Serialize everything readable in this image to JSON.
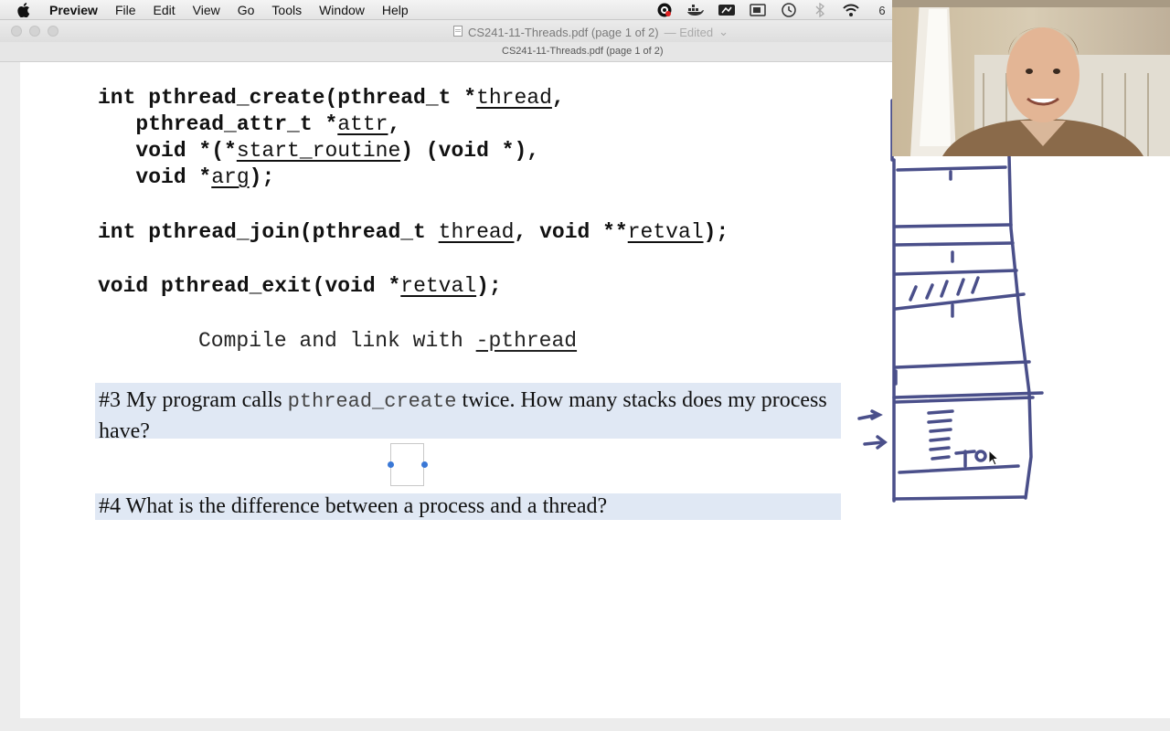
{
  "menubar": {
    "app": "Preview",
    "items": [
      "File",
      "Edit",
      "View",
      "Go",
      "Tools",
      "Window",
      "Help"
    ],
    "status_icons": [
      "creative-cloud-icon",
      "docker-icon",
      "cloud-sync-icon",
      "screen-capture-icon",
      "time-machine-icon",
      "bluetooth-icon",
      "wifi-icon"
    ],
    "clock_partial": "6"
  },
  "window": {
    "title": "CS241-11-Threads.pdf (page 1 of 2)",
    "edited": "— Edited",
    "page_info": "CS241-11-Threads.pdf (page 1 of 2)"
  },
  "document": {
    "create": {
      "l1_prefix": "int pthread_create(pthread_t *",
      "l1_arg": "thread",
      "l1_suffix": ",",
      "l2_prefix": "   pthread_attr_t *",
      "l2_arg": "attr",
      "l2_suffix": ",",
      "l3_prefix": "   void *(*",
      "l3_arg": "start_routine",
      "l3_suffix": ") (void *),",
      "l4_prefix": "   void *",
      "l4_arg": "arg",
      "l4_suffix": ");"
    },
    "join": {
      "prefix": "int pthread_join(pthread_t ",
      "arg1": "thread",
      "middle": ", void **",
      "arg2": "retval",
      "suffix": ");"
    },
    "exit": {
      "prefix": "void pthread_exit(void *",
      "arg": "retval",
      "suffix": ");"
    },
    "compile": {
      "text": "Compile and link with ",
      "flag": "-pthread"
    },
    "q3": {
      "prefix": "#3 My program calls ",
      "code": "pthread_create",
      "suffix": " twice. How many stacks does my process have?"
    },
    "q4": "#4 What is the difference between a process and a thread?"
  },
  "colors": {
    "question_bg": "#e0e8f4",
    "ink": "#4a4f8a",
    "handle": "#3a78d6"
  }
}
